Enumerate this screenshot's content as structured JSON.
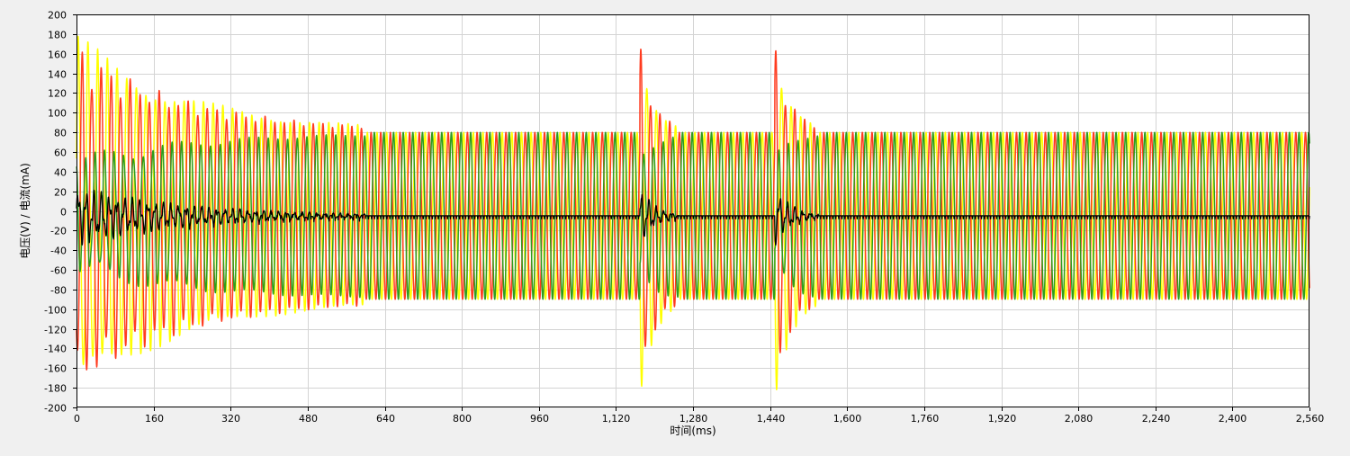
{
  "chart_data": {
    "type": "line",
    "xlabel": "时间(ms)",
    "ylabel": "电压(V) / 电流(mA)",
    "xlim": [
      0,
      2560
    ],
    "ylim": [
      -200,
      200
    ],
    "x_ticks": [
      "0",
      "160",
      "320",
      "480",
      "640",
      "800",
      "960",
      "1,120",
      "1,280",
      "1,440",
      "1,600",
      "1,760",
      "1,920",
      "2,080",
      "2,240",
      "2,400",
      "2,560"
    ],
    "y_ticks": [
      "200",
      "180",
      "160",
      "140",
      "120",
      "100",
      "80",
      "60",
      "40",
      "20",
      "0",
      "-20",
      "-40",
      "-60",
      "-80",
      "-100",
      "-120",
      "-140",
      "-160",
      "-180",
      "-200"
    ],
    "grid": true,
    "legend": "none",
    "waveform": {
      "period_ms": 20,
      "steady_amplitude": 85,
      "steady_offset": -5,
      "disturbance_windows_ms": [
        [
          0,
          600
        ],
        [
          1170,
          1250
        ],
        [
          1450,
          1540
        ]
      ],
      "peak_values": {
        "yellow_max": 162,
        "yellow_min": -183,
        "red_max": 160,
        "red_min": -160,
        "green_max": 85,
        "green_min": -90,
        "black_max": 30,
        "black_min": -38
      }
    },
    "series": [
      {
        "color": "#ffff00"
      },
      {
        "color": "#ff3b1f"
      },
      {
        "color": "#2e9c1e"
      },
      {
        "color": "#000000"
      }
    ]
  }
}
